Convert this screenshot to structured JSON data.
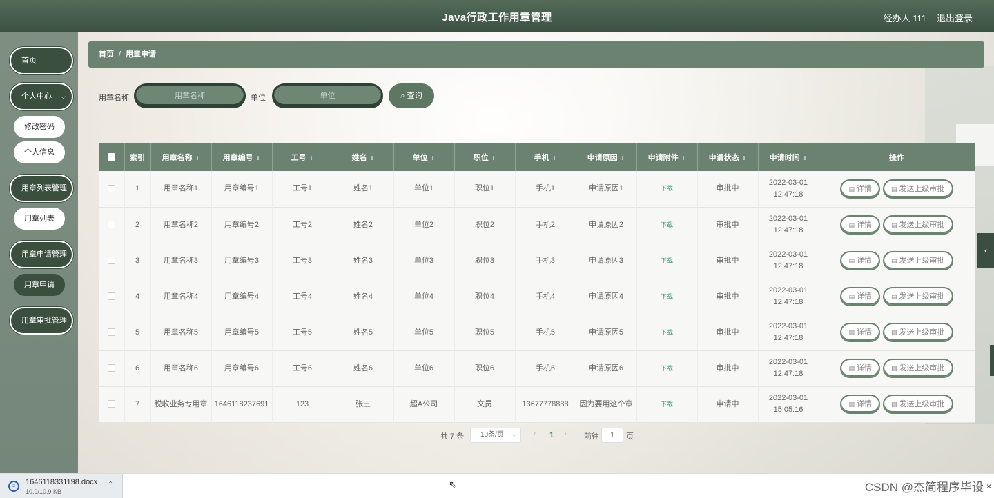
{
  "header": {
    "title": "Java行政工作用章管理",
    "user": "经办人 111",
    "logout": "退出登录"
  },
  "sidebar": {
    "items": [
      {
        "label": "首页"
      },
      {
        "label": "个人中心",
        "chevron": "chevron-down-icon",
        "children": [
          "修改密码",
          "个人信息"
        ]
      },
      {
        "label": "用章列表管理",
        "children": [
          "用章列表"
        ]
      },
      {
        "label": "用章申请管理",
        "children": [
          "用章申请"
        ],
        "active_child": "用章申请"
      },
      {
        "label": "用章审批管理"
      }
    ]
  },
  "breadcrumb": {
    "home": "首页",
    "separator": "/",
    "current": "用章申请"
  },
  "search": {
    "name_label": "用章名称",
    "name_placeholder": "用章名称",
    "unit_label": "单位",
    "unit_placeholder": "单位",
    "button": "查询",
    "button_icon": "search-icon"
  },
  "table": {
    "headers": [
      "索引",
      "用章名称",
      "用章编号",
      "工号",
      "姓名",
      "单位",
      "职位",
      "手机",
      "申请原因",
      "申请附件",
      "申请状态",
      "申请时间",
      "操作"
    ],
    "rows": [
      [
        "1",
        "用章名称1",
        "用章编号1",
        "工号1",
        "姓名1",
        "单位1",
        "职位1",
        "手机1",
        "申请原因1",
        "下载",
        "审批中",
        "2022-03-01 12:47:18"
      ],
      [
        "2",
        "用章名称2",
        "用章编号2",
        "工号2",
        "姓名2",
        "单位2",
        "职位2",
        "手机2",
        "申请原因2",
        "下载",
        "审批中",
        "2022-03-01 12:47:18"
      ],
      [
        "3",
        "用章名称3",
        "用章编号3",
        "工号3",
        "姓名3",
        "单位3",
        "职位3",
        "手机3",
        "申请原因3",
        "下载",
        "审批中",
        "2022-03-01 12:47:18"
      ],
      [
        "4",
        "用章名称4",
        "用章编号4",
        "工号4",
        "姓名4",
        "单位4",
        "职位4",
        "手机4",
        "申请原因4",
        "下载",
        "审批中",
        "2022-03-01 12:47:18"
      ],
      [
        "5",
        "用章名称5",
        "用章编号5",
        "工号5",
        "姓名5",
        "单位5",
        "职位5",
        "手机5",
        "申请原因5",
        "下载",
        "审批中",
        "2022-03-01 12:47:18"
      ],
      [
        "6",
        "用章名称6",
        "用章编号6",
        "工号6",
        "姓名6",
        "单位6",
        "职位6",
        "手机6",
        "申请原因6",
        "下载",
        "审批中",
        "2022-03-01 12:47:18"
      ],
      [
        "7",
        "税收业务专用章",
        "1646118237691",
        "123",
        "张三",
        "超A公司",
        "文员",
        "13677778888",
        "因为要用这个章",
        "下载",
        "申请中",
        "2022-03-01 15:05:16"
      ]
    ],
    "actions": {
      "detail": "详情",
      "send": "发送上级审批"
    }
  },
  "pagination": {
    "total": "共 7 条",
    "page_size": "10条/页",
    "current": "1",
    "goto": "前往",
    "goto_value": "1",
    "page_unit": "页"
  },
  "download_bar": {
    "file_name": "1646118331198.docx",
    "file_size": "10.9/10.9 KB"
  },
  "watermark": "CSDN @杰简程序毕设",
  "colors": {
    "header": "#3c5142",
    "sidebar": "#7e8f82",
    "accent": "#6b8270",
    "dark_pill": "#3b4f3f",
    "download_link": "#3aa57a"
  }
}
